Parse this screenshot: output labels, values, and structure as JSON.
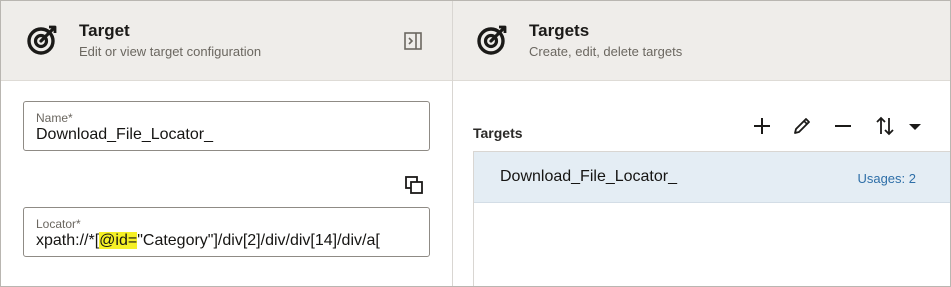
{
  "left_panel": {
    "title": "Target",
    "subtitle": "Edit or view target configuration",
    "icon": "target-icon",
    "collapse_icon": "collapse-panel-icon",
    "name_field": {
      "label": "Name*",
      "value": "Download_File_Locator_"
    },
    "copy_icon": "copy-icon",
    "locator_field": {
      "label": "Locator*",
      "value_before": "xpath://*[",
      "value_highlight": "@id=",
      "value_after": "\"Category\"]/div[2]/div/div[14]/div/a["
    }
  },
  "right_panel": {
    "title": "Targets",
    "subtitle": "Create, edit, delete targets",
    "icon": "target-icon",
    "list_label": "Targets",
    "toolbar": [
      "add-icon",
      "edit-pencil-icon",
      "remove-icon",
      "sort-icon",
      "caret-down-icon"
    ],
    "targets": [
      {
        "name": "Download_File_Locator_",
        "usages": "Usages: 2"
      }
    ]
  },
  "colors": {
    "header_bg": "#efedea",
    "selected_row_bg": "#e4edf4",
    "usage_link": "#2e6fa8",
    "highlight": "#f5f026"
  }
}
